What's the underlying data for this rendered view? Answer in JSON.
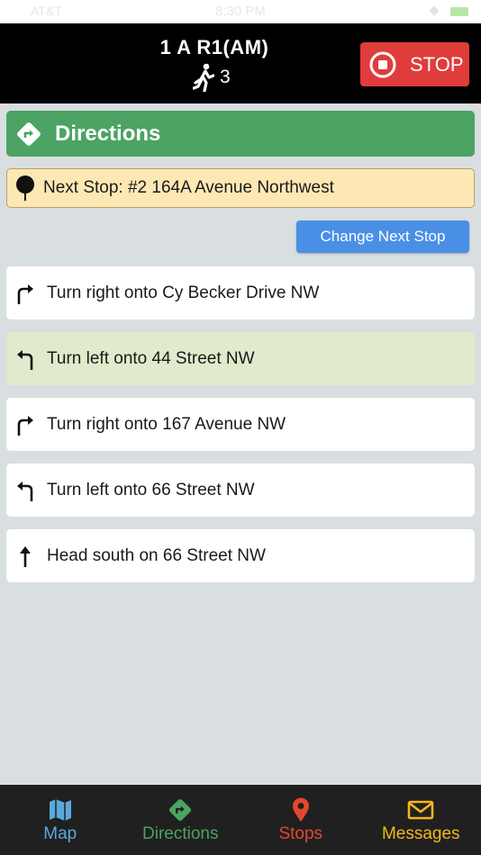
{
  "status_bar": {
    "carrier": "AT&T",
    "time": "8:30 PM"
  },
  "header": {
    "route_title": "1 A R1(AM)",
    "passenger_count": "3",
    "stop_label": "STOP"
  },
  "directions": {
    "title": "Directions"
  },
  "next_stop": {
    "text": "Next Stop: #2 164A Avenue Northwest"
  },
  "change_next_stop": {
    "label": "Change Next Stop"
  },
  "steps": [
    {
      "text": "Turn right onto Cy Becker Drive NW",
      "icon": "turn-right-icon",
      "active": false
    },
    {
      "text": "Turn left onto 44 Street NW",
      "icon": "turn-left-icon",
      "active": true
    },
    {
      "text": "Turn right onto 167 Avenue NW",
      "icon": "turn-right-icon",
      "active": false
    },
    {
      "text": "Turn left onto 66 Street NW",
      "icon": "turn-left-icon",
      "active": false
    },
    {
      "text": "Head south on 66 Street NW",
      "icon": "straight-arrow-icon",
      "active": false
    }
  ],
  "tabs": [
    {
      "label": "Map",
      "icon": "map-icon",
      "color": "#5aa9dc"
    },
    {
      "label": "Directions",
      "icon": "directions-icon",
      "color": "#4ca363"
    },
    {
      "label": "Stops",
      "icon": "location-pin-icon",
      "color": "#e3472f"
    },
    {
      "label": "Messages",
      "icon": "envelope-icon",
      "color": "#f3b71b"
    }
  ],
  "colors": {
    "stop_button": "#e13c3c",
    "directions_header": "#4ca363",
    "next_stop_background": "#fde8b4",
    "change_button": "#4a8fe6",
    "active_step": "#dfebcc"
  }
}
